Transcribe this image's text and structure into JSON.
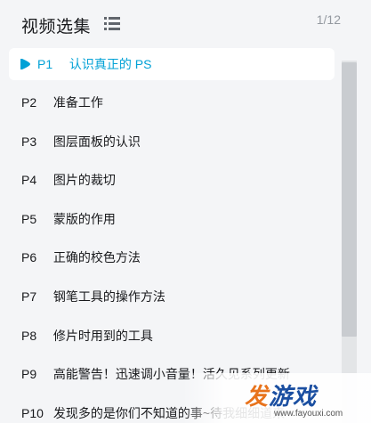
{
  "header": {
    "title": "视频选集",
    "counter": "1/12"
  },
  "episodes": [
    {
      "num": "P1",
      "title": "认识真正的 PS",
      "active": true
    },
    {
      "num": "P2",
      "title": "准备工作"
    },
    {
      "num": "P3",
      "title": "图层面板的认识"
    },
    {
      "num": "P4",
      "title": "图片的裁切"
    },
    {
      "num": "P5",
      "title": "蒙版的作用"
    },
    {
      "num": "P6",
      "title": "正确的校色方法"
    },
    {
      "num": "P7",
      "title": "钢笔工具的操作方法"
    },
    {
      "num": "P8",
      "title": "修片时用到的工具"
    },
    {
      "num": "P9",
      "title": "高能警告！迅速调小音量！活久见系列更新"
    },
    {
      "num": "P10",
      "title": "发现多的是你们不知道的事~待我细细道来~"
    }
  ],
  "scrollbar": {
    "position": 0.0
  },
  "watermark": {
    "logo_a": "发",
    "logo_b": "游戏",
    "url": "www.fayouxi.com"
  },
  "colors": {
    "accent": "#00a1d6",
    "panel_bg": "#f4f5f7",
    "watermark_orange": "#e8731c",
    "watermark_blue": "#1b4fa1"
  }
}
